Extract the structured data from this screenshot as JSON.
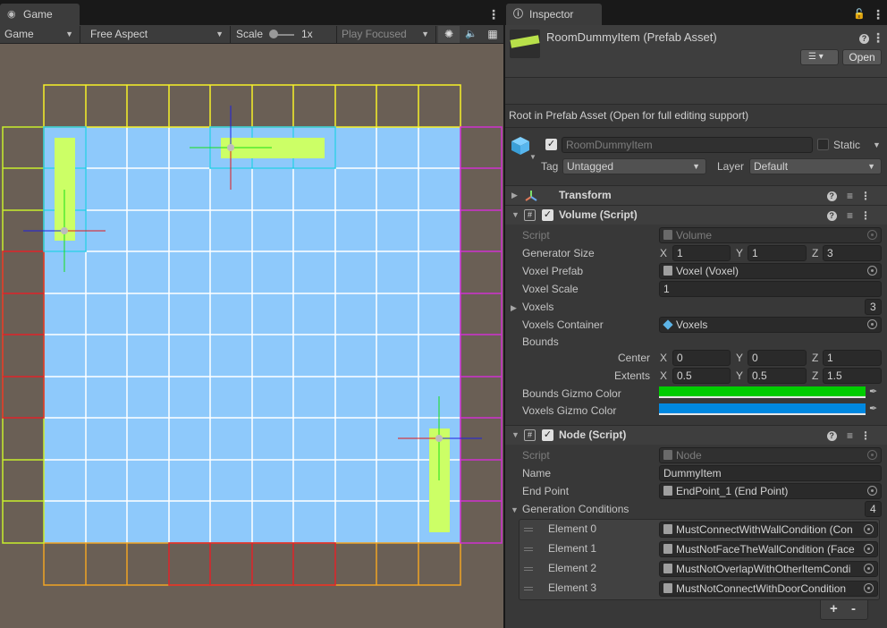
{
  "game_panel": {
    "tab_label": "Game",
    "display_select": "Game",
    "aspect_select": "Free Aspect",
    "scale_label": "Scale",
    "scale_value": "1x",
    "play_mode_select": "Play Focused"
  },
  "inspector": {
    "tab_label": "Inspector",
    "asset_title": "RoomDummyItem (Prefab Asset)",
    "open_button": "Open",
    "prefab_notice": "Root in Prefab Asset (Open for full editing support)",
    "object_name": "RoomDummyItem",
    "static_label": "Static",
    "tag_label": "Tag",
    "tag_value": "Untagged",
    "layer_label": "Layer",
    "layer_value": "Default",
    "components": {
      "transform": {
        "title": "Transform"
      },
      "volume": {
        "title": "Volume (Script)",
        "script_label": "Script",
        "script_value": "Volume",
        "generator_size_label": "Generator Size",
        "generator_size": {
          "x": "1",
          "y": "1",
          "z": "3"
        },
        "voxel_prefab_label": "Voxel Prefab",
        "voxel_prefab_value": "Voxel (Voxel)",
        "voxel_scale_label": "Voxel Scale",
        "voxel_scale_value": "1",
        "voxels_label": "Voxels",
        "voxels_count": "3",
        "voxels_container_label": "Voxels Container",
        "voxels_container_value": "Voxels",
        "bounds_label": "Bounds",
        "center_label": "Center",
        "center": {
          "x": "0",
          "y": "0",
          "z": "1"
        },
        "extents_label": "Extents",
        "extents": {
          "x": "0.5",
          "y": "0.5",
          "z": "1.5"
        },
        "bounds_gizmo_color_label": "Bounds Gizmo Color",
        "bounds_gizmo_color": "#00cc00",
        "voxels_gizmo_color_label": "Voxels Gizmo Color",
        "voxels_gizmo_color": "#0088e0"
      },
      "node": {
        "title": "Node (Script)",
        "script_label": "Script",
        "script_value": "Node",
        "name_label": "Name",
        "name_value": "DummyItem",
        "end_point_label": "End Point",
        "end_point_value": "EndPoint_1 (End Point)",
        "generation_conditions_label": "Generation Conditions",
        "generation_conditions_count": "4",
        "elements": [
          {
            "label": "Element 0",
            "value": "MustConnectWithWallCondition (Con"
          },
          {
            "label": "Element 1",
            "value": "MustNotFaceTheWallCondition (Face"
          },
          {
            "label": "Element 2",
            "value": "MustNotOverlapWithOtherItemCondi"
          },
          {
            "label": "Element 3",
            "value": "MustNotConnectWithDoorCondition"
          }
        ]
      }
    },
    "axis_x": "X",
    "axis_y": "Y",
    "axis_z": "Z",
    "add_button": "+",
    "remove_button": "-"
  }
}
